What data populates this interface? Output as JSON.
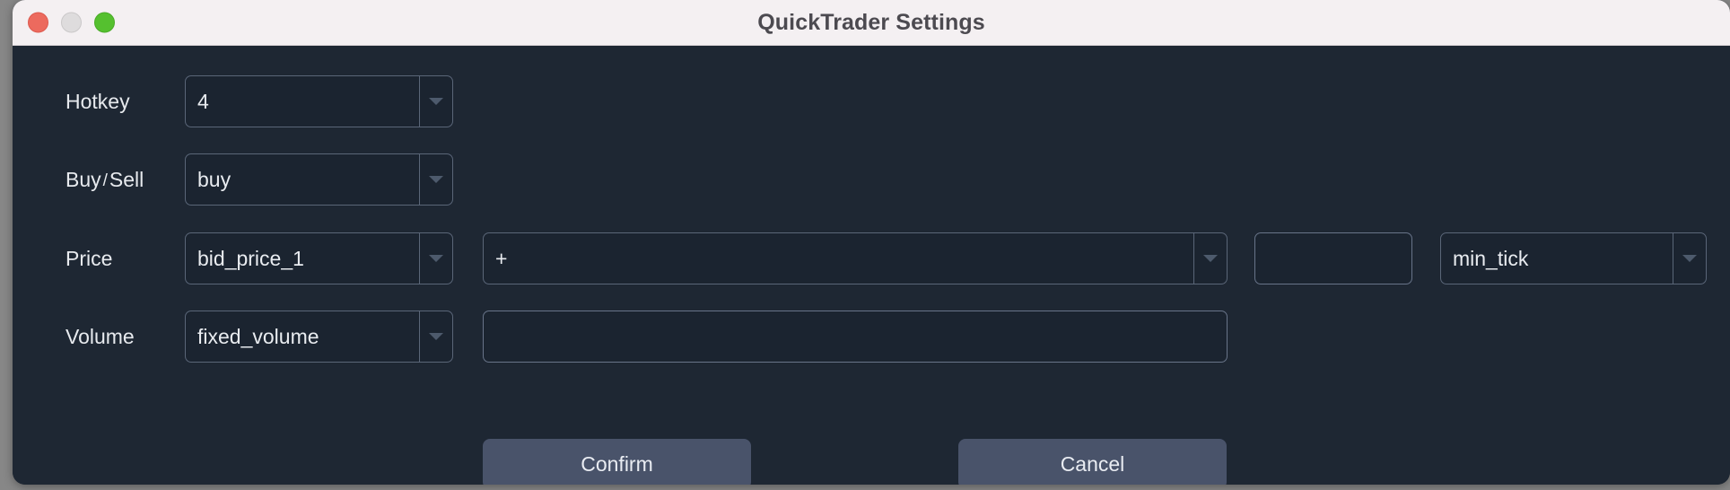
{
  "window": {
    "title": "QuickTrader Settings",
    "traffic_lights": [
      {
        "name": "close",
        "color": "#ec6a5e"
      },
      {
        "name": "minimize",
        "color": "#dedcdd"
      },
      {
        "name": "maximize",
        "color": "#55c02f"
      }
    ]
  },
  "colors": {
    "window_background": "#1e2733",
    "titlebar_background": "#f4f0f2",
    "field_border": "#5a6678",
    "field_border_light": "#687489",
    "button_background": "#49536a",
    "text": "#e9ecf0",
    "caret": "#4d5a6c"
  },
  "form": {
    "hotkey": {
      "label": "Hotkey",
      "value": "4",
      "placeholder": ""
    },
    "buy_sell": {
      "label_first": "Buy",
      "label_separator": "/",
      "label_second": "Sell",
      "value": "buy"
    },
    "price": {
      "label": "Price",
      "source_value": "bid_price_1",
      "operator_value": "+",
      "offset_value": "",
      "offset_placeholder": "",
      "unit_value": "min_tick"
    },
    "volume": {
      "label": "Volume",
      "mode_value": "fixed_volume",
      "amount_value": "",
      "amount_placeholder": ""
    }
  },
  "actions": {
    "confirm_label": "Confirm",
    "cancel_label": "Cancel"
  },
  "icons": {
    "chevron_down": "chevron-down-icon"
  }
}
